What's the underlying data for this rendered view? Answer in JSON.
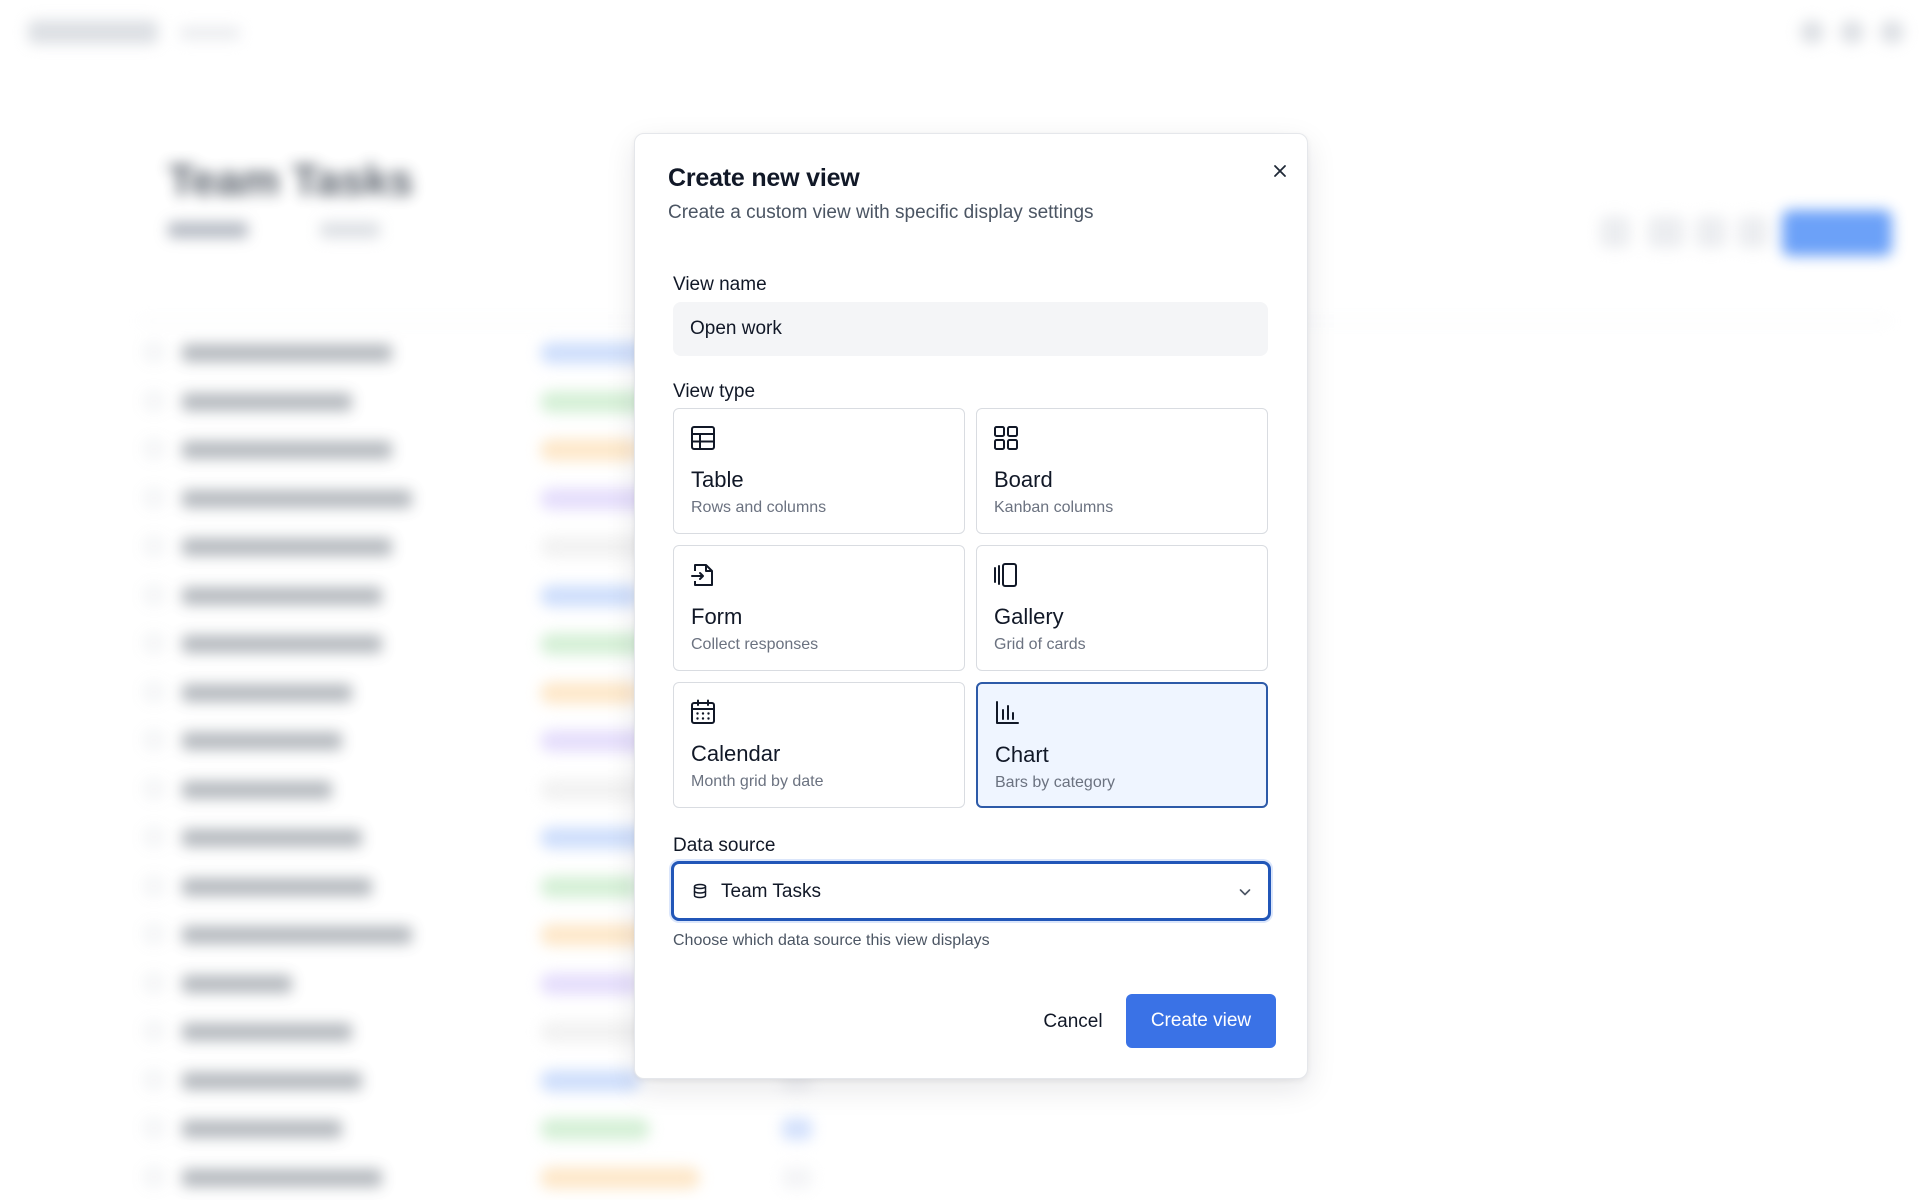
{
  "background": {
    "page_title": "Team Tasks"
  },
  "dialog": {
    "title": "Create new view",
    "description": "Create a custom view with specific display settings",
    "close_icon": "close-icon",
    "view_name": {
      "label": "View name",
      "value": "Open work"
    },
    "view_type": {
      "label": "View type",
      "selected": "Chart",
      "options": [
        {
          "label": "Table",
          "description": "Rows and columns",
          "icon": "table-icon"
        },
        {
          "label": "Board",
          "description": "Kanban columns",
          "icon": "board-icon"
        },
        {
          "label": "Form",
          "description": "Collect responses",
          "icon": "form-icon"
        },
        {
          "label": "Gallery",
          "description": "Grid of cards",
          "icon": "gallery-icon"
        },
        {
          "label": "Calendar",
          "description": "Month grid by date",
          "icon": "calendar-icon"
        },
        {
          "label": "Chart",
          "description": "Bars by category",
          "icon": "chart-icon"
        }
      ]
    },
    "data_source": {
      "label": "Data source",
      "value": "Team Tasks",
      "icon": "database-icon",
      "helper": "Choose which data source this view displays"
    },
    "actions": {
      "cancel": "Cancel",
      "create": "Create view"
    }
  },
  "colors": {
    "primary": "#3a72e6",
    "selected_border": "#2d5aa8",
    "selected_bg": "#eff5ff",
    "focus_border": "#2156b8"
  }
}
